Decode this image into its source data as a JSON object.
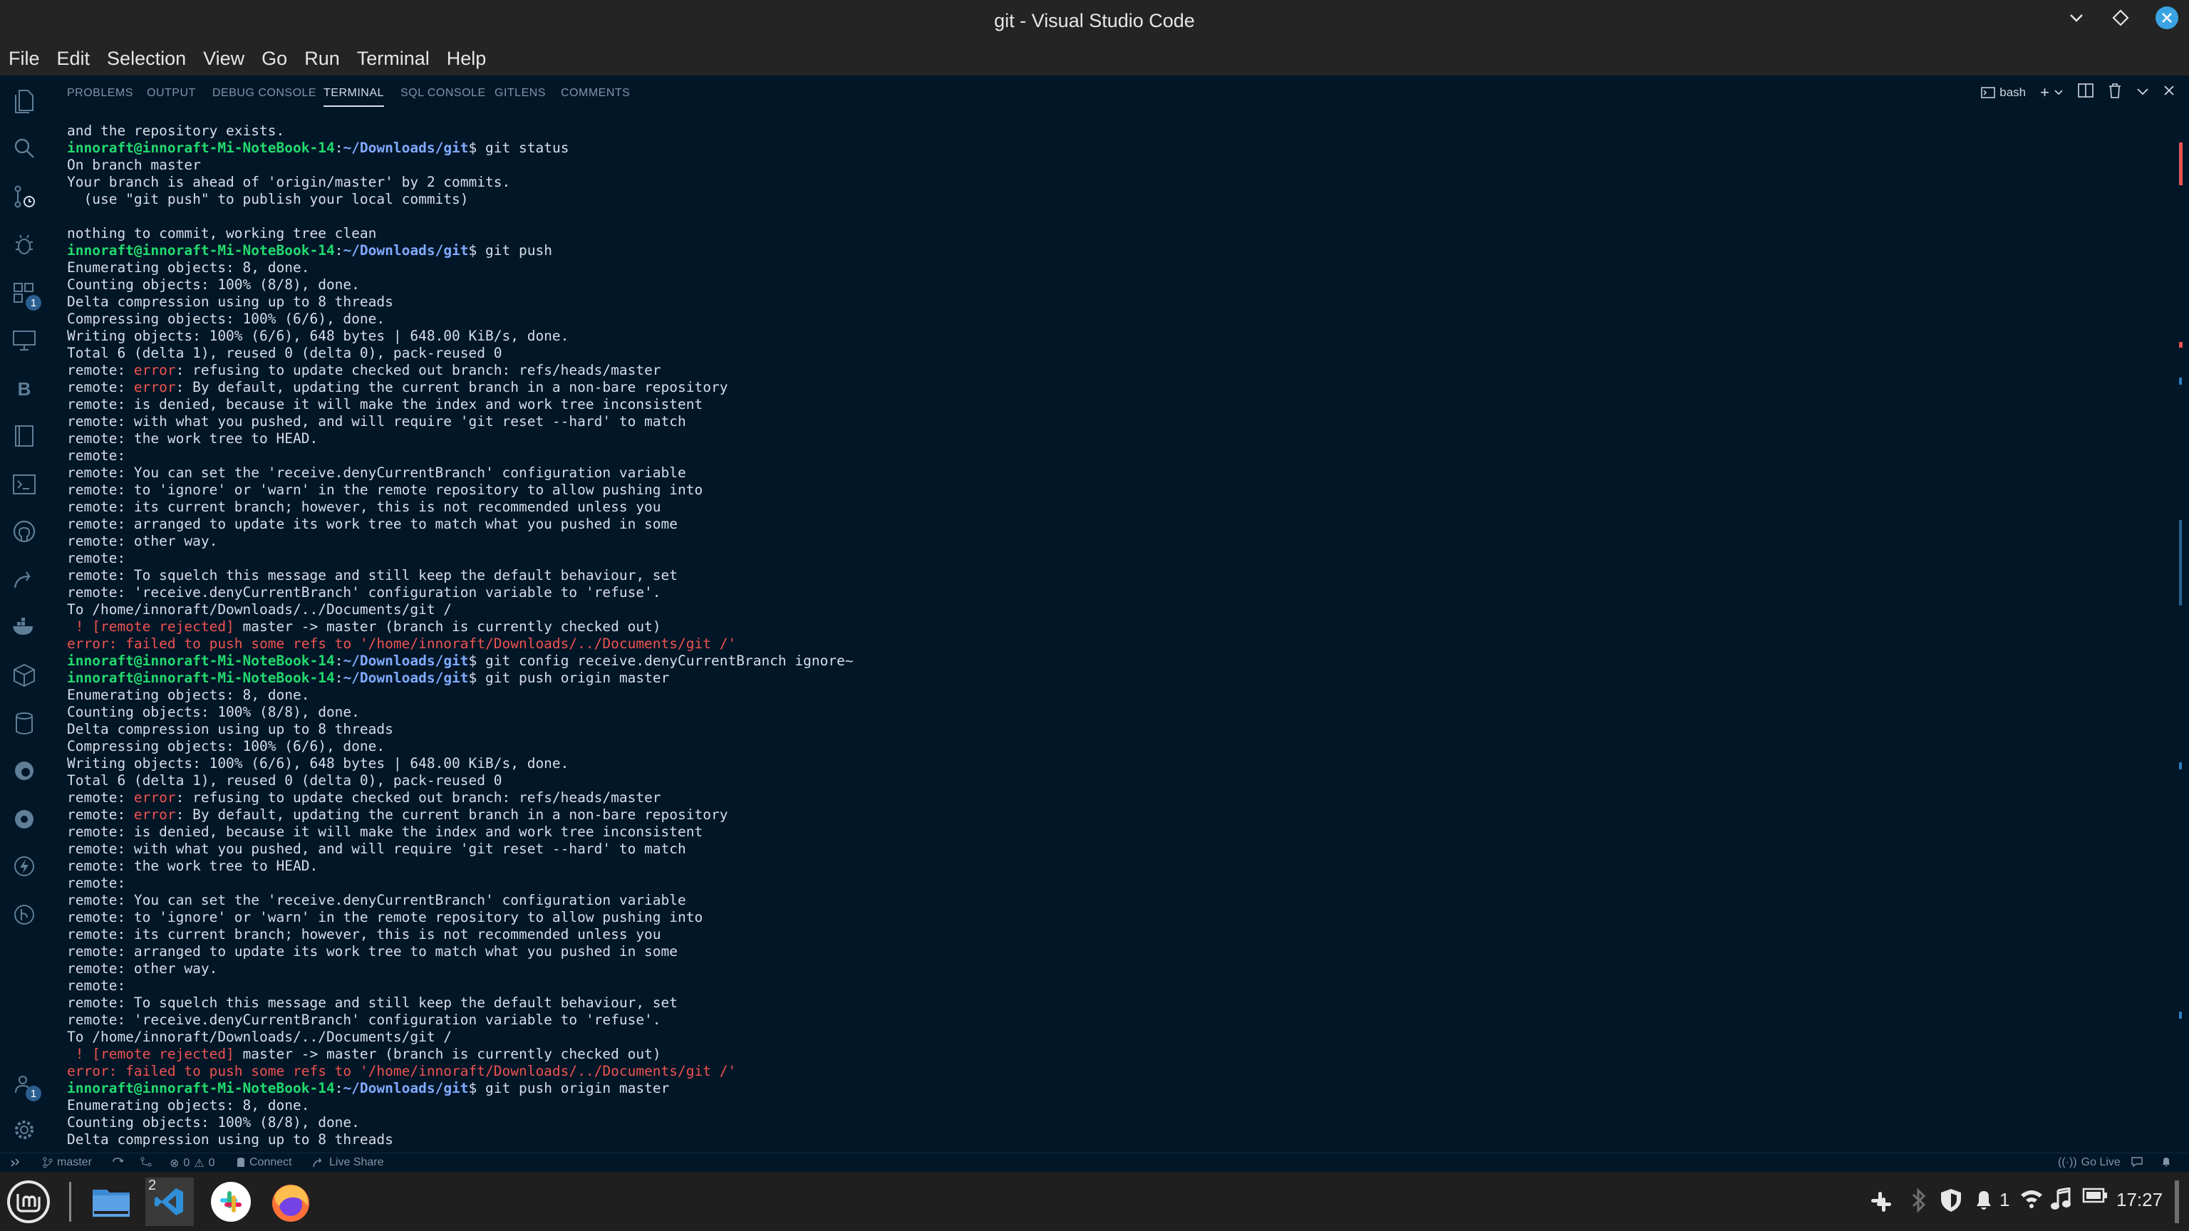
{
  "window": {
    "title": "git - Visual Studio Code"
  },
  "menu": [
    "File",
    "Edit",
    "Selection",
    "View",
    "Go",
    "Run",
    "Terminal",
    "Help"
  ],
  "activity_badges": {
    "source_control": "1",
    "remote": "1",
    "accounts": "1"
  },
  "panel": {
    "tabs": [
      "PROBLEMS",
      "OUTPUT",
      "DEBUG CONSOLE",
      "TERMINAL",
      "SQL CONSOLE",
      "GITLENS",
      "COMMENTS"
    ],
    "active_tab": "TERMINAL",
    "shell": "bash",
    "add_label": "+"
  },
  "prompt": {
    "user": "innoraft@innoraft-Mi-NoteBook-14",
    "path": "~/Downloads/git"
  },
  "terminal_lines": [
    {
      "t": "text",
      "s": "and the repository exists."
    },
    {
      "t": "prompt",
      "status": "ok",
      "cmd": "git status"
    },
    {
      "t": "text",
      "s": "On branch master"
    },
    {
      "t": "text",
      "s": "Your branch is ahead of 'origin/master' by 2 commits."
    },
    {
      "t": "text",
      "s": "  (use \"git push\" to publish your local commits)"
    },
    {
      "t": "text",
      "s": ""
    },
    {
      "t": "text",
      "s": "nothing to commit, working tree clean"
    },
    {
      "t": "prompt",
      "status": "fail",
      "cmd": "git push"
    },
    {
      "t": "text",
      "s": "Enumerating objects: 8, done."
    },
    {
      "t": "text",
      "s": "Counting objects: 100% (8/8), done."
    },
    {
      "t": "text",
      "s": "Delta compression using up to 8 threads"
    },
    {
      "t": "text",
      "s": "Compressing objects: 100% (6/6), done."
    },
    {
      "t": "text",
      "s": "Writing objects: 100% (6/6), 648 bytes | 648.00 KiB/s, done."
    },
    {
      "t": "text",
      "s": "Total 6 (delta 1), reused 0 (delta 0), pack-reused 0"
    },
    {
      "t": "remerr",
      "s": "refusing to update checked out branch: refs/heads/master"
    },
    {
      "t": "remerr",
      "s": "By default, updating the current branch in a non-bare repository"
    },
    {
      "t": "text",
      "s": "remote: is denied, because it will make the index and work tree inconsistent"
    },
    {
      "t": "text",
      "s": "remote: with what you pushed, and will require 'git reset --hard' to match"
    },
    {
      "t": "text",
      "s": "remote: the work tree to HEAD."
    },
    {
      "t": "text",
      "s": "remote:"
    },
    {
      "t": "text",
      "s": "remote: You can set the 'receive.denyCurrentBranch' configuration variable"
    },
    {
      "t": "text",
      "s": "remote: to 'ignore' or 'warn' in the remote repository to allow pushing into"
    },
    {
      "t": "text",
      "s": "remote: its current branch; however, this is not recommended unless you"
    },
    {
      "t": "text",
      "s": "remote: arranged to update its work tree to match what you pushed in some"
    },
    {
      "t": "text",
      "s": "remote: other way."
    },
    {
      "t": "text",
      "s": "remote:"
    },
    {
      "t": "text",
      "s": "remote: To squelch this message and still keep the default behaviour, set"
    },
    {
      "t": "text",
      "s": "remote: 'receive.denyCurrentBranch' configuration variable to 'refuse'."
    },
    {
      "t": "text",
      "s": "To /home/innoraft/Downloads/../Documents/git /"
    },
    {
      "t": "rejected",
      "s": "master -> master (branch is currently checked out)"
    },
    {
      "t": "error",
      "s": "error: failed to push some refs to '/home/innoraft/Downloads/../Documents/git /'"
    },
    {
      "t": "prompt",
      "status": "ok",
      "cmd": "git config receive.denyCurrentBranch ignore~"
    },
    {
      "t": "prompt",
      "status": "fail",
      "cmd": "git push origin master"
    },
    {
      "t": "text",
      "s": "Enumerating objects: 8, done."
    },
    {
      "t": "text",
      "s": "Counting objects: 100% (8/8), done."
    },
    {
      "t": "text",
      "s": "Delta compression using up to 8 threads"
    },
    {
      "t": "text",
      "s": "Compressing objects: 100% (6/6), done."
    },
    {
      "t": "text",
      "s": "Writing objects: 100% (6/6), 648 bytes | 648.00 KiB/s, done."
    },
    {
      "t": "text",
      "s": "Total 6 (delta 1), reused 0 (delta 0), pack-reused 0"
    },
    {
      "t": "remerr",
      "s": "refusing to update checked out branch: refs/heads/master"
    },
    {
      "t": "remerr",
      "s": "By default, updating the current branch in a non-bare repository"
    },
    {
      "t": "text",
      "s": "remote: is denied, because it will make the index and work tree inconsistent"
    },
    {
      "t": "text",
      "s": "remote: with what you pushed, and will require 'git reset --hard' to match"
    },
    {
      "t": "text",
      "s": "remote: the work tree to HEAD."
    },
    {
      "t": "text",
      "s": "remote:"
    },
    {
      "t": "text",
      "s": "remote: You can set the 'receive.denyCurrentBranch' configuration variable"
    },
    {
      "t": "text",
      "s": "remote: to 'ignore' or 'warn' in the remote repository to allow pushing into"
    },
    {
      "t": "text",
      "s": "remote: its current branch; however, this is not recommended unless you"
    },
    {
      "t": "text",
      "s": "remote: arranged to update its work tree to match what you pushed in some"
    },
    {
      "t": "text",
      "s": "remote: other way."
    },
    {
      "t": "text",
      "s": "remote:"
    },
    {
      "t": "text",
      "s": "remote: To squelch this message and still keep the default behaviour, set"
    },
    {
      "t": "text",
      "s": "remote: 'receive.denyCurrentBranch' configuration variable to 'refuse'."
    },
    {
      "t": "text",
      "s": "To /home/innoraft/Downloads/../Documents/git /"
    },
    {
      "t": "rejected",
      "s": "master -> master (branch is currently checked out)"
    },
    {
      "t": "error",
      "s": "error: failed to push some refs to '/home/innoraft/Downloads/../Documents/git /'"
    },
    {
      "t": "prompt",
      "status": "ok",
      "cmd": "git push origin master"
    },
    {
      "t": "text",
      "s": "Enumerating objects: 8, done."
    },
    {
      "t": "text",
      "s": "Counting objects: 100% (8/8), done."
    },
    {
      "t": "text",
      "s": "Delta compression using up to 8 threads"
    }
  ],
  "labels": {
    "remote_prefix": "remote: ",
    "error_word": "error",
    "rejected_tag": " ! [remote rejected]"
  },
  "statusbar": {
    "branch": "master",
    "errors": "0",
    "warnings": "0",
    "connect": "Connect",
    "live_share": "Live Share",
    "go_live": "Go Live"
  },
  "taskbar": {
    "vscode_count": "2",
    "notifications": "1",
    "clock": "17:27"
  },
  "colors": {
    "bg": "#011627",
    "prompt_user": "#22da6e",
    "prompt_path": "#82aaff",
    "error": "#ef5350",
    "chrome": "#242424"
  }
}
